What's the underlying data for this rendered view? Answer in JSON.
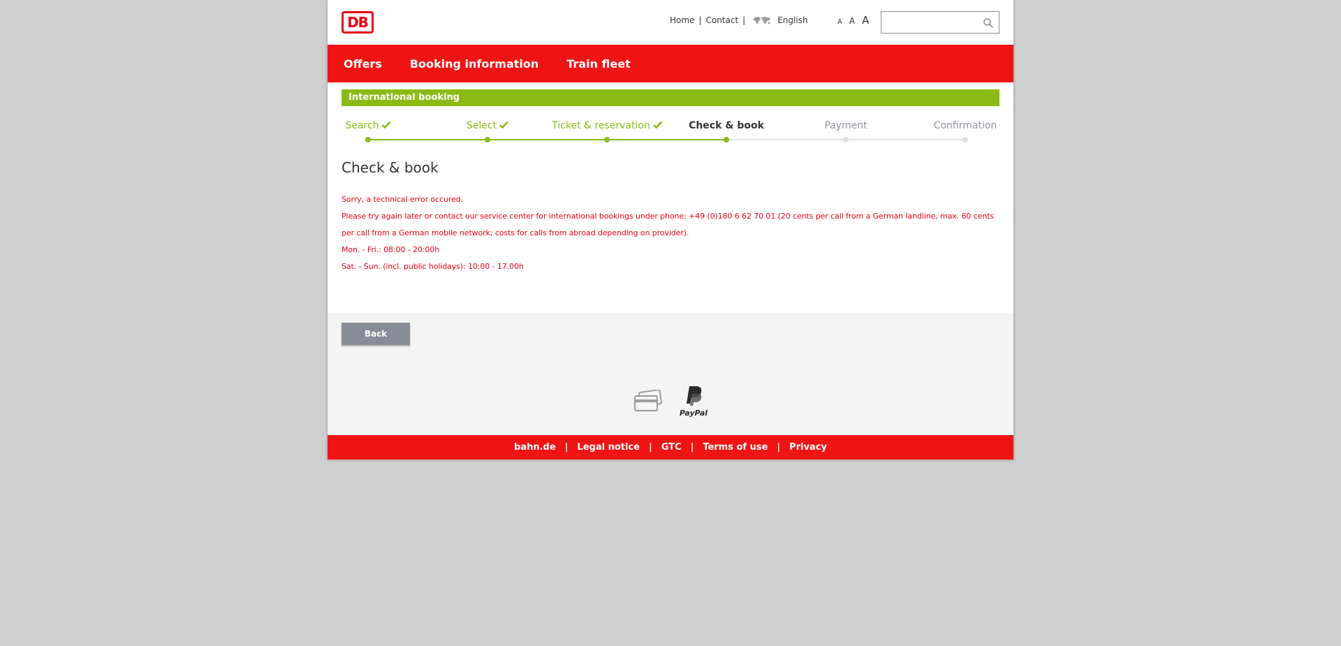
{
  "header": {
    "logo_text": "DB",
    "meta_nav": {
      "home": "Home",
      "contact": "Contact",
      "language": "English",
      "separator": "|"
    },
    "font_size": {
      "small": "A",
      "medium": "A",
      "large": "A"
    },
    "search": {
      "value": "",
      "placeholder": ""
    }
  },
  "main_nav": {
    "items": [
      {
        "label": "Offers"
      },
      {
        "label": "Booking information"
      },
      {
        "label": "Train fleet"
      }
    ]
  },
  "section_bar": {
    "title": "International booking"
  },
  "stepper": {
    "steps": [
      {
        "label": "Search",
        "status": "done"
      },
      {
        "label": "Select",
        "status": "done"
      },
      {
        "label": "Ticket & reservation",
        "status": "done"
      },
      {
        "label": "Check & book",
        "status": "current"
      },
      {
        "label": "Payment",
        "status": "todo"
      },
      {
        "label": "Confirmation",
        "status": "todo"
      }
    ]
  },
  "main": {
    "title": "Check & book",
    "error_lines": [
      "Sorry, a technical error occured.",
      "Please try again later or contact our service center for international bookings under phone: +49 (0)180 6 62 70 01 (20 cents per call from a German landline, max. 60 cents per call from a German mobile network; costs for calls from abroad depending on provider).",
      "Mon. - Fri.: 08:00 - 20:00h",
      "Sat. - Sun. (incl. public holidays): 10:00 - 17.00h"
    ],
    "back_label": "Back"
  },
  "payment_icons": [
    "credit-card-icon",
    "paypal-icon"
  ],
  "paypal_text": "PayPal",
  "footer": {
    "separator": "|",
    "links": [
      {
        "label": "bahn.de"
      },
      {
        "label": "Legal notice"
      },
      {
        "label": "GTC"
      },
      {
        "label": "Terms of use"
      },
      {
        "label": "Privacy"
      }
    ]
  },
  "colors": {
    "brand_red": "#f01414",
    "accent_green": "#8aba14",
    "error_red": "#ec0016",
    "button_grey": "#878c96",
    "inactive_grey": "#8f949d"
  }
}
